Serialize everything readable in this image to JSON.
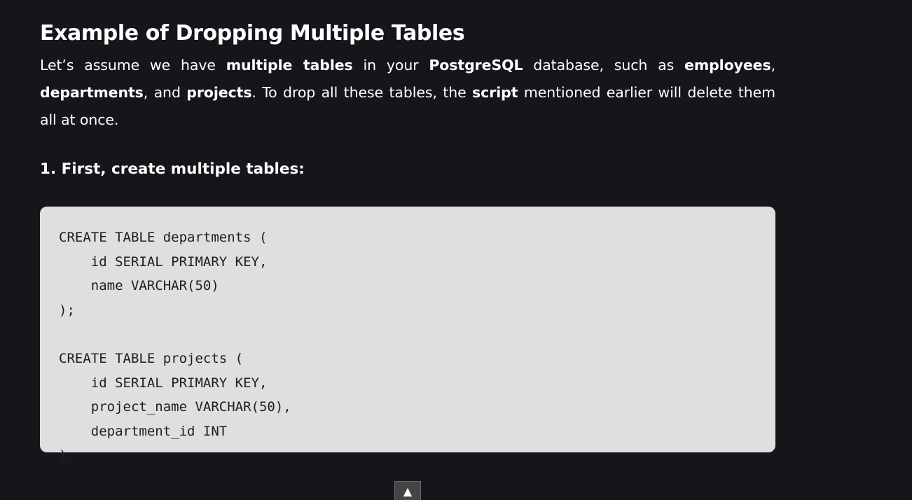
{
  "heading": "Example of Dropping Multiple Tables",
  "paragraph": {
    "t1": "Let’s assume we have ",
    "b1": "multiple tables",
    "t2": " in your ",
    "b2": "PostgreSQL",
    "t3": " database, such as ",
    "b3": "employees",
    "t4": ", ",
    "b4": "departments",
    "t5": ", and ",
    "b5": "projects",
    "t6": ". To drop all these tables, the ",
    "b6": "script",
    "t7": " mentioned earlier will delete them all at once."
  },
  "step_heading": "1. First, create multiple tables:",
  "code": "CREATE TABLE departments (\n    id SERIAL PRIMARY KEY,\n    name VARCHAR(50)\n);\n\nCREATE TABLE projects (\n    id SERIAL PRIMARY KEY,\n    project_name VARCHAR(50),\n    department_id INT\n);",
  "scroll_top_icon": "▲"
}
